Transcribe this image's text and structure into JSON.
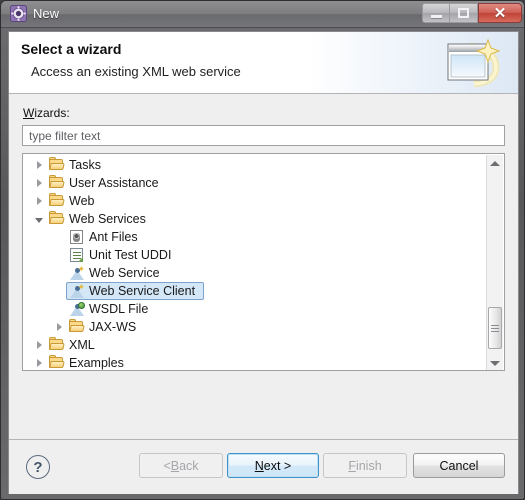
{
  "window": {
    "title": "New",
    "icon": "gear-icon",
    "controls": {
      "minimize": "–",
      "maximize": "□",
      "close": "✕"
    }
  },
  "header": {
    "title": "Select a wizard",
    "subtitle": "Access an existing XML web service",
    "graphic": "wizard-window-sparkle-icon"
  },
  "content": {
    "wizards_label_prefix": "W",
    "wizards_label_rest": "izards:",
    "filter": {
      "value": "",
      "placeholder": "type filter text"
    },
    "tree": [
      {
        "label": "Tasks",
        "indent": 0,
        "state": "collapsed",
        "icon": "folder-icon",
        "selected": false
      },
      {
        "label": "User Assistance",
        "indent": 0,
        "state": "collapsed",
        "icon": "folder-icon",
        "selected": false
      },
      {
        "label": "Web",
        "indent": 0,
        "state": "collapsed",
        "icon": "folder-icon",
        "selected": false
      },
      {
        "label": "Web Services",
        "indent": 0,
        "state": "expanded",
        "icon": "folder-icon",
        "selected": false
      },
      {
        "label": "Ant Files",
        "indent": 1,
        "state": "leaf",
        "icon": "ant-file-icon",
        "selected": false
      },
      {
        "label": "Unit Test UDDI",
        "indent": 1,
        "state": "leaf",
        "icon": "document-icon",
        "selected": false
      },
      {
        "label": "Web Service",
        "indent": 1,
        "state": "leaf",
        "icon": "web-service-icon",
        "selected": false
      },
      {
        "label": "Web Service Client",
        "indent": 1,
        "state": "leaf",
        "icon": "web-service-client-icon",
        "selected": true
      },
      {
        "label": "WSDL File",
        "indent": 1,
        "state": "leaf",
        "icon": "wsdl-file-icon",
        "selected": false
      },
      {
        "label": "JAX-WS",
        "indent": 1,
        "state": "collapsed",
        "icon": "folder-icon",
        "selected": false
      },
      {
        "label": "XML",
        "indent": 0,
        "state": "collapsed",
        "icon": "folder-icon",
        "selected": false
      },
      {
        "label": "Examples",
        "indent": 0,
        "state": "collapsed",
        "icon": "folder-icon",
        "selected": false
      }
    ]
  },
  "buttons": {
    "help": "?",
    "back": {
      "prefix": "< ",
      "accel": "B",
      "rest": "ack",
      "enabled": false
    },
    "next": {
      "prefix": "",
      "accel": "N",
      "rest": "ext >",
      "enabled": true,
      "default": true
    },
    "finish": {
      "prefix": "",
      "accel": "F",
      "rest": "inish",
      "enabled": false
    },
    "cancel": {
      "label": "Cancel",
      "enabled": true
    }
  },
  "colors": {
    "selection_bg": "#d3e7f7",
    "selection_border": "#7da2ce",
    "default_button_border": "#3c92c9",
    "close_button": "#bf4437",
    "folder": "#fcd98a"
  }
}
